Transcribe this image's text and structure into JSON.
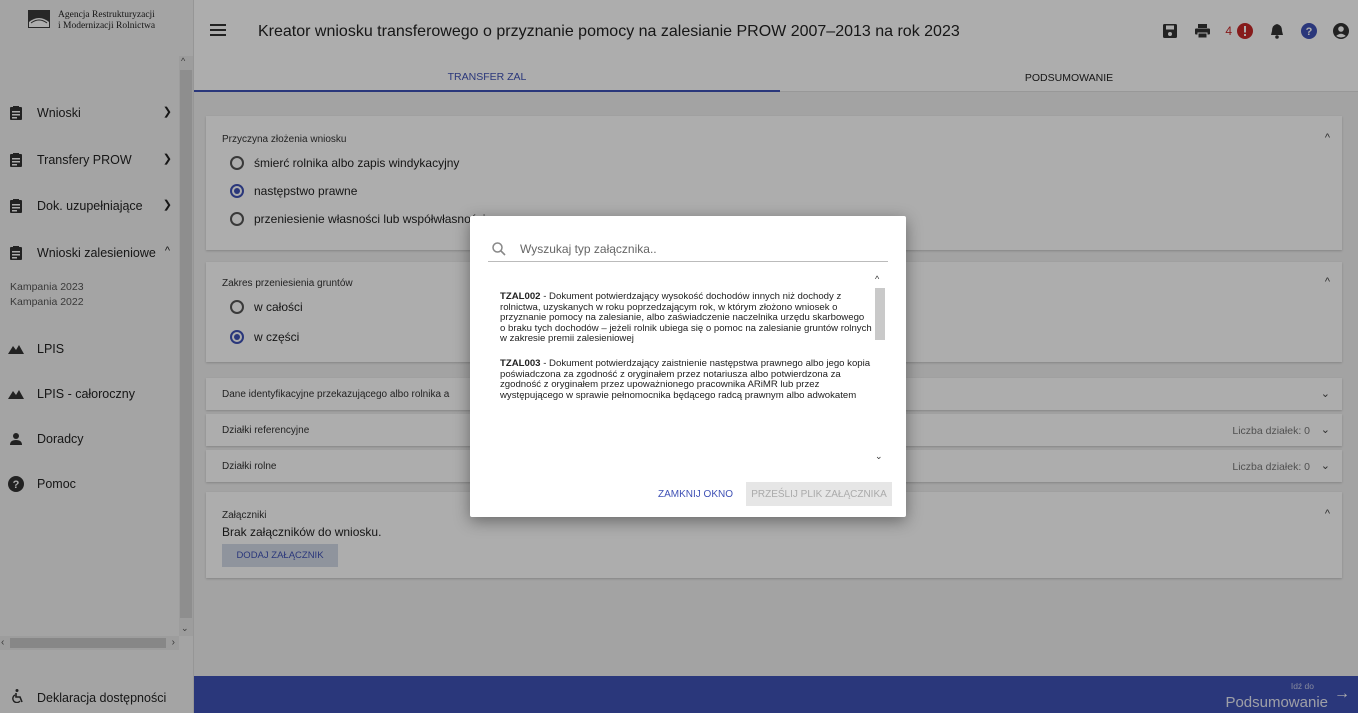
{
  "app": {
    "logo_line1": "Agencja Restrukturyzacji",
    "logo_line2": "i Modernizacji Rolnictwa",
    "title": "Kreator wniosku transferowego o przyznanie pomocy na zalesianie PROW 2007–2013 na rok 2023",
    "notifications_count": "4"
  },
  "sidebar": {
    "items": [
      {
        "label": "Wnioski",
        "icon": "document-icon",
        "expanded": false
      },
      {
        "label": "Transfery PROW",
        "icon": "document-icon",
        "expanded": false
      },
      {
        "label": "Dok. uzupełniające",
        "icon": "document-icon",
        "expanded": false
      },
      {
        "label": "Wnioski zalesieniowe",
        "icon": "document-icon",
        "expanded": true
      },
      {
        "label": "LPIS",
        "icon": "mountain-icon"
      },
      {
        "label": "LPIS - całoroczny",
        "icon": "mountain-icon"
      },
      {
        "label": "Doradcy",
        "icon": "person-icon"
      },
      {
        "label": "Pomoc",
        "icon": "help-icon"
      }
    ],
    "subitems": [
      "Kampania 2023",
      "Kampania 2022"
    ],
    "bottom": "Deklaracja dostępności"
  },
  "tabs": [
    "TRANSFER ZAL",
    "PODSUMOWANIE"
  ],
  "sections": {
    "reason": {
      "title": "Przyczyna złożenia wniosku",
      "options": [
        "śmierć rolnika albo zapis windykacyjny",
        "następstwo prawne",
        "przeniesienie własności lub współwłasności"
      ],
      "selected": 1
    },
    "scope": {
      "title": "Zakres przeniesienia gruntów",
      "options": [
        "w całości",
        "w części"
      ],
      "selected": 1
    },
    "identification": {
      "title": "Dane identyfikacyjne przekazującego albo rolnika a"
    },
    "reference_plots": {
      "title": "Działki referencyjne",
      "count_label": "Liczba działek: 0"
    },
    "farm_plots": {
      "title": "Działki rolne",
      "count_label": "Liczba działek: 0"
    },
    "attachments": {
      "title": "Załączniki",
      "empty_text": "Brak załączników do wniosku.",
      "add_button": "DODAJ ZAŁĄCZNIK"
    }
  },
  "footer": {
    "goto_small": "Idź do",
    "goto_big": "Podsumowanie"
  },
  "dialog": {
    "search_placeholder": "Wyszukaj typ załącznika..",
    "items": [
      {
        "code": "TZAL002",
        "text": " - Dokument potwierdzający wysokość dochodów innych niż dochody z rolnictwa, uzyskanych w roku poprzedzającym rok, w którym złożono wniosek o przyznanie pomocy na zalesianie, albo zaświadczenie naczelnika urzędu skarbowego o braku tych dochodów – jeżeli rolnik ubiega się o pomoc na zalesianie gruntów rolnych w zakresie premii zalesieniowej"
      },
      {
        "code": "TZAL003",
        "text": " - Dokument potwierdzający zaistnienie następstwa prawnego albo jego kopia poświadczona za zgodność z oryginałem przez notariusza albo potwierdzona za zgodność z oryginałem przez upoważnionego pracownika ARiMR lub przez występującego w sprawie pełnomocnika będącego radcą prawnym albo adwokatem"
      }
    ],
    "close_button": "ZAMKNIJ OKNO",
    "upload_button": "PRZEŚLIJ PLIK ZAŁĄCZNIKA"
  },
  "colors": {
    "primary": "#3f51b5",
    "alert": "#c62828",
    "help": "#3f51b5"
  }
}
